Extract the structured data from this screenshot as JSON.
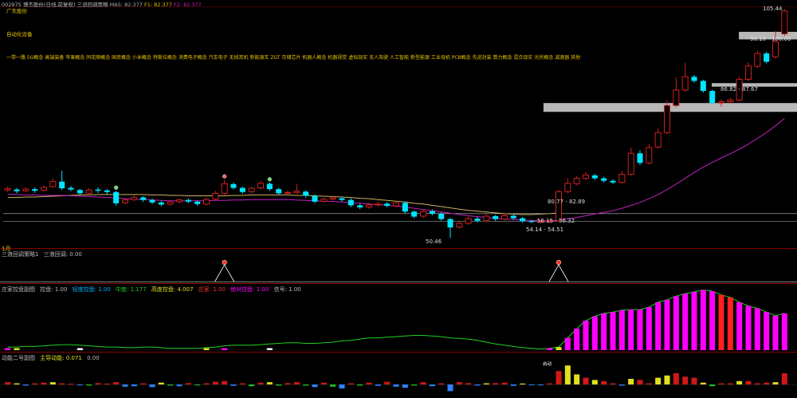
{
  "header": {
    "code": "002975",
    "name": "博杰股份(日线,前复权)",
    "indicator_name": "三浪回调策略",
    "ma_label": "MA5: 82.377",
    "f1_label": "F1: 82.377",
    "f2_label": "F2: 82.377"
  },
  "concepts": {
    "line1": "广东股份",
    "line2": "自动化设备",
    "tags": "一带一路 5G概念 高端装备 苹果概念 同花顺概念 国资概念 小米概念 特斯拉概念 消费电子概念 汽车电子 无线耳机 新能源车 ZGT 存储芯片 机器人概念 机器视觉 虚拟现实 无人驾驶 人工智能 新型能源 工业母机 PCB概念 先进封装 算力概念 混合现实 光伏概念 减速器 其他"
  },
  "price_labels": {
    "high": "105.44",
    "zone1": "98.18 - 100.00",
    "zone2": "86.82 - 87.67",
    "zone3": "80.77 - 82.89",
    "zone4": "56.15 - 56.32",
    "zone5": "54.14 - 54.51",
    "low": "50.46"
  },
  "sub1": {
    "title": "三浪回调策略1",
    "value_label": "三浪回调: 0.00"
  },
  "sub2": {
    "title": "庄家控盘副图",
    "items": [
      "控盘: 1.00",
      "轻度控盘: 1.00",
      "中度: 1.177",
      "高度控盘: 4.007",
      "庄家: 1.00",
      "绝对控盘: 1.00",
      "信号: 1.00"
    ]
  },
  "sub3": {
    "title": "动能二号副图",
    "value_label": "主导动能: 0.071",
    "value2": "0.00",
    "peak_tag": "启动"
  },
  "left_marker": "1月",
  "colors": {
    "up": "#d02020",
    "down": "#00e5ff",
    "ma1": "#c020c0",
    "ma2": "#d0b060",
    "magenta": "#ff00ff",
    "green": "#20d020",
    "yellow": "#e0e020"
  },
  "chart_data": {
    "type": "candlestick",
    "candles": [
      {
        "o": 62.0,
        "c": 62.3,
        "h": 62.8,
        "l": 61.5
      },
      {
        "o": 62.1,
        "c": 61.7,
        "h": 62.5,
        "l": 61.2
      },
      {
        "o": 61.8,
        "c": 62.2,
        "h": 62.6,
        "l": 61.4
      },
      {
        "o": 62.2,
        "c": 61.8,
        "h": 62.6,
        "l": 61.3
      },
      {
        "o": 61.9,
        "c": 62.6,
        "h": 63.1,
        "l": 61.6
      },
      {
        "o": 62.8,
        "c": 64.0,
        "h": 64.8,
        "l": 62.5
      },
      {
        "o": 64.0,
        "c": 62.4,
        "h": 66.6,
        "l": 62.0
      },
      {
        "o": 62.5,
        "c": 62.1,
        "h": 63.0,
        "l": 61.7
      },
      {
        "o": 62.0,
        "c": 61.2,
        "h": 62.3,
        "l": 60.9
      },
      {
        "o": 61.2,
        "c": 62.0,
        "h": 62.4,
        "l": 60.8
      },
      {
        "o": 62.1,
        "c": 61.8,
        "h": 62.6,
        "l": 61.3
      },
      {
        "o": 61.9,
        "c": 61.5,
        "h": 62.2,
        "l": 61.0
      },
      {
        "o": 61.5,
        "c": 58.8,
        "h": 61.8,
        "l": 58.2
      },
      {
        "o": 58.9,
        "c": 59.6,
        "h": 60.1,
        "l": 58.5
      },
      {
        "o": 59.7,
        "c": 60.2,
        "h": 60.7,
        "l": 59.3
      },
      {
        "o": 60.2,
        "c": 59.6,
        "h": 60.5,
        "l": 59.1
      },
      {
        "o": 59.6,
        "c": 59.0,
        "h": 59.9,
        "l": 58.6
      },
      {
        "o": 59.0,
        "c": 58.5,
        "h": 59.4,
        "l": 58.1
      },
      {
        "o": 58.6,
        "c": 59.1,
        "h": 59.6,
        "l": 58.2
      },
      {
        "o": 59.2,
        "c": 59.6,
        "h": 60.0,
        "l": 58.8
      },
      {
        "o": 59.6,
        "c": 59.2,
        "h": 60.0,
        "l": 58.8
      },
      {
        "o": 59.2,
        "c": 58.6,
        "h": 59.5,
        "l": 58.2
      },
      {
        "o": 58.6,
        "c": 59.7,
        "h": 60.2,
        "l": 58.3
      },
      {
        "o": 59.8,
        "c": 61.2,
        "h": 61.8,
        "l": 59.5
      },
      {
        "o": 61.2,
        "c": 63.5,
        "h": 64.5,
        "l": 60.8
      },
      {
        "o": 63.4,
        "c": 62.5,
        "h": 63.8,
        "l": 62.1
      },
      {
        "o": 62.5,
        "c": 61.5,
        "h": 62.8,
        "l": 61.1
      },
      {
        "o": 61.6,
        "c": 62.4,
        "h": 62.8,
        "l": 61.2
      },
      {
        "o": 62.5,
        "c": 63.6,
        "h": 64.2,
        "l": 62.1
      },
      {
        "o": 63.5,
        "c": 62.2,
        "h": 63.8,
        "l": 61.8
      },
      {
        "o": 62.2,
        "c": 61.2,
        "h": 62.5,
        "l": 60.8
      },
      {
        "o": 61.2,
        "c": 61.4,
        "h": 61.9,
        "l": 60.9
      },
      {
        "o": 61.4,
        "c": 61.7,
        "h": 63.5,
        "l": 61.1
      },
      {
        "o": 61.6,
        "c": 60.6,
        "h": 61.9,
        "l": 60.2
      },
      {
        "o": 60.6,
        "c": 59.2,
        "h": 60.9,
        "l": 58.8
      },
      {
        "o": 59.3,
        "c": 59.8,
        "h": 60.2,
        "l": 58.9
      },
      {
        "o": 59.8,
        "c": 60.1,
        "h": 60.6,
        "l": 59.4
      },
      {
        "o": 60.0,
        "c": 59.6,
        "h": 60.4,
        "l": 59.2
      },
      {
        "o": 59.6,
        "c": 58.3,
        "h": 60.0,
        "l": 57.9
      },
      {
        "o": 58.3,
        "c": 57.8,
        "h": 58.7,
        "l": 57.4
      },
      {
        "o": 57.9,
        "c": 58.4,
        "h": 59.0,
        "l": 57.5
      },
      {
        "o": 58.4,
        "c": 58.6,
        "h": 59.2,
        "l": 58.0
      },
      {
        "o": 58.7,
        "c": 58.2,
        "h": 59.1,
        "l": 57.8
      },
      {
        "o": 58.2,
        "c": 58.9,
        "h": 59.3,
        "l": 57.8
      },
      {
        "o": 58.9,
        "c": 56.8,
        "h": 59.2,
        "l": 56.3
      },
      {
        "o": 56.8,
        "c": 55.6,
        "h": 57.1,
        "l": 55.2
      },
      {
        "o": 55.7,
        "c": 56.8,
        "h": 57.3,
        "l": 55.3
      },
      {
        "o": 56.9,
        "c": 56.3,
        "h": 57.3,
        "l": 55.9
      },
      {
        "o": 56.3,
        "c": 55.0,
        "h": 56.6,
        "l": 54.6
      },
      {
        "o": 55.0,
        "c": 53.0,
        "h": 55.3,
        "l": 50.46
      },
      {
        "o": 53.1,
        "c": 54.0,
        "h": 54.4,
        "l": 52.7
      },
      {
        "o": 54.0,
        "c": 55.1,
        "h": 55.6,
        "l": 53.6
      },
      {
        "o": 55.1,
        "c": 54.6,
        "h": 55.5,
        "l": 54.2
      },
      {
        "o": 54.6,
        "c": 55.7,
        "h": 56.2,
        "l": 54.2
      },
      {
        "o": 55.7,
        "c": 55.0,
        "h": 56.0,
        "l": 54.6
      },
      {
        "o": 55.0,
        "c": 55.8,
        "h": 56.3,
        "l": 54.6
      },
      {
        "o": 55.8,
        "c": 55.2,
        "h": 56.1,
        "l": 54.8
      },
      {
        "o": 55.2,
        "c": 54.5,
        "h": 55.5,
        "l": 54.1
      },
      {
        "o": 54.5,
        "c": 54.3,
        "h": 54.8,
        "l": 54.0
      },
      {
        "o": 54.3,
        "c": 54.5,
        "h": 54.8,
        "l": 54.0
      },
      {
        "o": 54.5,
        "c": 54.6,
        "h": 54.9,
        "l": 54.2
      },
      {
        "o": 54.6,
        "c": 61.6,
        "h": 62.0,
        "l": 54.4
      },
      {
        "o": 61.6,
        "c": 63.6,
        "h": 64.8,
        "l": 61.2
      },
      {
        "o": 63.5,
        "c": 64.8,
        "h": 65.3,
        "l": 63.1
      },
      {
        "o": 64.8,
        "c": 65.6,
        "h": 66.3,
        "l": 64.4
      },
      {
        "o": 65.5,
        "c": 64.8,
        "h": 65.9,
        "l": 64.4
      },
      {
        "o": 64.8,
        "c": 64.2,
        "h": 65.2,
        "l": 63.8
      },
      {
        "o": 64.2,
        "c": 63.8,
        "h": 64.6,
        "l": 63.4
      },
      {
        "o": 63.8,
        "c": 65.8,
        "h": 66.5,
        "l": 63.5
      },
      {
        "o": 65.8,
        "c": 70.8,
        "h": 72.2,
        "l": 65.4
      },
      {
        "o": 70.8,
        "c": 68.5,
        "h": 71.5,
        "l": 68.0
      },
      {
        "o": 68.5,
        "c": 72.2,
        "h": 73.0,
        "l": 68.1
      },
      {
        "o": 72.3,
        "c": 75.8,
        "h": 76.8,
        "l": 72.0
      },
      {
        "o": 75.8,
        "c": 82.3,
        "h": 83.5,
        "l": 75.4
      },
      {
        "o": 82.3,
        "c": 86.0,
        "h": 89.0,
        "l": 81.9
      },
      {
        "o": 86.0,
        "c": 89.2,
        "h": 92.5,
        "l": 85.6
      },
      {
        "o": 89.2,
        "c": 88.2,
        "h": 89.6,
        "l": 87.8
      },
      {
        "o": 88.2,
        "c": 85.8,
        "h": 88.5,
        "l": 85.4
      },
      {
        "o": 85.8,
        "c": 82.9,
        "h": 86.1,
        "l": 82.5
      },
      {
        "o": 82.9,
        "c": 83.2,
        "h": 83.8,
        "l": 82.1
      },
      {
        "o": 83.2,
        "c": 83.6,
        "h": 84.2,
        "l": 82.8
      },
      {
        "o": 83.6,
        "c": 88.6,
        "h": 89.2,
        "l": 83.2
      },
      {
        "o": 88.6,
        "c": 91.8,
        "h": 92.6,
        "l": 88.2
      },
      {
        "o": 91.7,
        "c": 94.8,
        "h": 95.5,
        "l": 91.3
      },
      {
        "o": 94.8,
        "c": 92.8,
        "h": 95.2,
        "l": 92.4
      },
      {
        "o": 94.0,
        "c": 97.6,
        "h": 100.2,
        "l": 93.6
      },
      {
        "o": 99.5,
        "c": 105.0,
        "h": 105.44,
        "l": 99.0
      }
    ],
    "ma_slow": [
      61.0,
      60.9,
      60.8,
      60.8,
      60.7,
      60.7,
      60.7,
      60.6,
      60.5,
      60.4,
      60.3,
      60.2,
      60.1,
      59.9,
      59.8,
      59.7,
      59.6,
      59.5,
      59.4,
      59.4,
      59.4,
      59.4,
      59.4,
      59.5,
      59.5,
      59.6,
      59.6,
      59.7,
      59.7,
      59.7,
      59.7,
      59.7,
      59.6,
      59.5,
      59.4,
      59.3,
      59.2,
      59.1,
      58.9,
      58.8,
      58.6,
      58.5,
      58.3,
      58.1,
      57.9,
      57.6,
      57.3,
      57.0,
      56.7,
      56.4,
      56.1,
      55.8,
      55.6,
      55.4,
      55.2,
      55.0,
      54.9,
      54.8,
      54.7,
      54.6,
      54.6,
      54.8,
      55.1,
      55.4,
      55.8,
      56.2,
      56.6,
      57.0,
      57.6,
      58.3,
      59.0,
      59.9,
      60.9,
      62.1,
      63.4,
      64.8,
      66.2,
      67.5,
      68.6,
      69.7,
      70.7,
      71.8,
      73.0,
      74.4,
      75.8,
      77.4,
      79.2
    ],
    "ma_fast": [
      60.2,
      60.2,
      60.3,
      60.3,
      60.4,
      60.5,
      60.6,
      60.7,
      60.8,
      60.8,
      60.9,
      60.9,
      60.9,
      60.9,
      60.9,
      60.9,
      60.8,
      60.8,
      60.7,
      60.7,
      60.6,
      60.6,
      60.6,
      60.6,
      60.6,
      60.7,
      60.7,
      60.8,
      60.8,
      60.8,
      60.8,
      60.8,
      60.7,
      60.7,
      60.6,
      60.5,
      60.4,
      60.3,
      60.2,
      60.0,
      59.9,
      59.7,
      59.5,
      59.3,
      59.1,
      58.8,
      58.6,
      58.3,
      58.0,
      57.7,
      57.4,
      57.1,
      56.9,
      56.7,
      56.5,
      56.3,
      56.2,
      56.1,
      56.1,
      56.2,
      56.3,
      56.5,
      56.8,
      57.1,
      57.4,
      57.7,
      58.0,
      58.4,
      58.9,
      59.4,
      60.0,
      60.7,
      61.4,
      62.3,
      63.2,
      64.1,
      65.0,
      65.8,
      66.5,
      67.2,
      67.9,
      68.7,
      69.5,
      70.4,
      71.3,
      72.3,
      73.3
    ],
    "zones": [
      {
        "from": 0.9362,
        "to": 0.9362,
        "y1": 98.18,
        "y2": 100.0
      },
      {
        "from": 0.9016,
        "to": 0.9016,
        "y1": 86.82,
        "y2": 87.67
      },
      {
        "from": 0.6875,
        "to": 0.6875,
        "y1": 80.77,
        "y2": 82.89
      },
      {
        "from": 0.0,
        "to": 0.0,
        "y1": 56.15,
        "y2": 56.32
      },
      {
        "from": 0.0,
        "to": 0.0,
        "y1": 54.14,
        "y2": 54.51
      }
    ],
    "signals": [
      {
        "index": 12,
        "kind": "green"
      },
      {
        "index": 24,
        "kind": "red"
      },
      {
        "index": 29,
        "kind": "green"
      }
    ],
    "sub1_spikes": [
      24,
      61
    ],
    "sub2_bars": [
      0.01,
      0.01,
      0.0,
      0.0,
      0.0,
      0.0,
      0.0,
      0.0,
      0.01,
      0.0,
      0.0,
      0.0,
      0.0,
      0.0,
      0.0,
      0.0,
      0.0,
      0.0,
      0.0,
      0.0,
      0.0,
      0.0,
      0.01,
      0.0,
      0.01,
      0.0,
      0.0,
      0.0,
      0.0,
      0.01,
      0.0,
      0.0,
      0.0,
      0.0,
      0.0,
      0.0,
      0.0,
      0.0,
      0.0,
      0.0,
      0.0,
      0.0,
      0.0,
      0.0,
      0.0,
      0.0,
      0.0,
      0.0,
      0.0,
      0.0,
      0.0,
      0.0,
      0.0,
      0.0,
      0.0,
      0.0,
      0.0,
      0.0,
      0.0,
      0.0,
      0.01,
      0.05,
      0.2,
      0.35,
      0.48,
      0.55,
      0.6,
      0.62,
      0.65,
      0.66,
      0.66,
      0.7,
      0.78,
      0.82,
      0.88,
      0.92,
      0.95,
      0.98,
      0.96,
      0.9,
      0.86,
      0.78,
      0.72,
      0.68,
      0.62,
      0.56,
      0.6
    ],
    "sub2_line": [
      0.05,
      0.05,
      0.06,
      0.06,
      0.07,
      0.08,
      0.09,
      0.09,
      0.08,
      0.07,
      0.06,
      0.05,
      0.05,
      0.04,
      0.04,
      0.05,
      0.05,
      0.04,
      0.03,
      0.03,
      0.03,
      0.03,
      0.04,
      0.05,
      0.07,
      0.08,
      0.08,
      0.08,
      0.09,
      0.1,
      0.11,
      0.12,
      0.12,
      0.11,
      0.11,
      0.12,
      0.13,
      0.15,
      0.16,
      0.18,
      0.2,
      0.2,
      0.21,
      0.22,
      0.23,
      0.24,
      0.24,
      0.23,
      0.22,
      0.2,
      0.19,
      0.18,
      0.16,
      0.13,
      0.1,
      0.08,
      0.06,
      0.04,
      0.03,
      0.02,
      0.03,
      0.05,
      0.2,
      0.35,
      0.48,
      0.55,
      0.6,
      0.62,
      0.65,
      0.66,
      0.66,
      0.7,
      0.78,
      0.82,
      0.88,
      0.92,
      0.95,
      0.98,
      0.96,
      0.9,
      0.86,
      0.78,
      0.72,
      0.68,
      0.62,
      0.56,
      0.6
    ],
    "sub3_bars": [
      0.1,
      0.05,
      -0.05,
      0.05,
      0.08,
      0.1,
      0.05,
      0.03,
      -0.04,
      -0.05,
      0.06,
      0.04,
      0.1,
      -0.1,
      -0.08,
      0.05,
      -0.12,
      0.08,
      -0.05,
      -0.08,
      0.06,
      -0.04,
      0.05,
      0.12,
      0.15,
      -0.06,
      0.05,
      -0.08,
      0.08,
      0.1,
      -0.05,
      0.06,
      0.1,
      -0.05,
      -0.12,
      0.08,
      -0.1,
      -0.18,
      0.05,
      -0.05,
      0.08,
      -0.06,
      0.12,
      -0.1,
      -0.15,
      -0.05,
      0.1,
      -0.08,
      0.05,
      -0.3,
      0.1,
      0.06,
      -0.05,
      0.05,
      0.06,
      0.08,
      -0.06,
      0.04,
      -0.03,
      -0.04,
      0.05,
      0.6,
      0.85,
      0.45,
      0.3,
      0.2,
      0.15,
      0.05,
      -0.05,
      0.25,
      0.2,
      0.05,
      0.3,
      0.4,
      0.5,
      0.35,
      0.3,
      0.08,
      -0.08,
      0.05,
      0.05,
      0.15,
      0.15,
      0.05,
      0.08,
      0.1,
      0.5
    ]
  }
}
